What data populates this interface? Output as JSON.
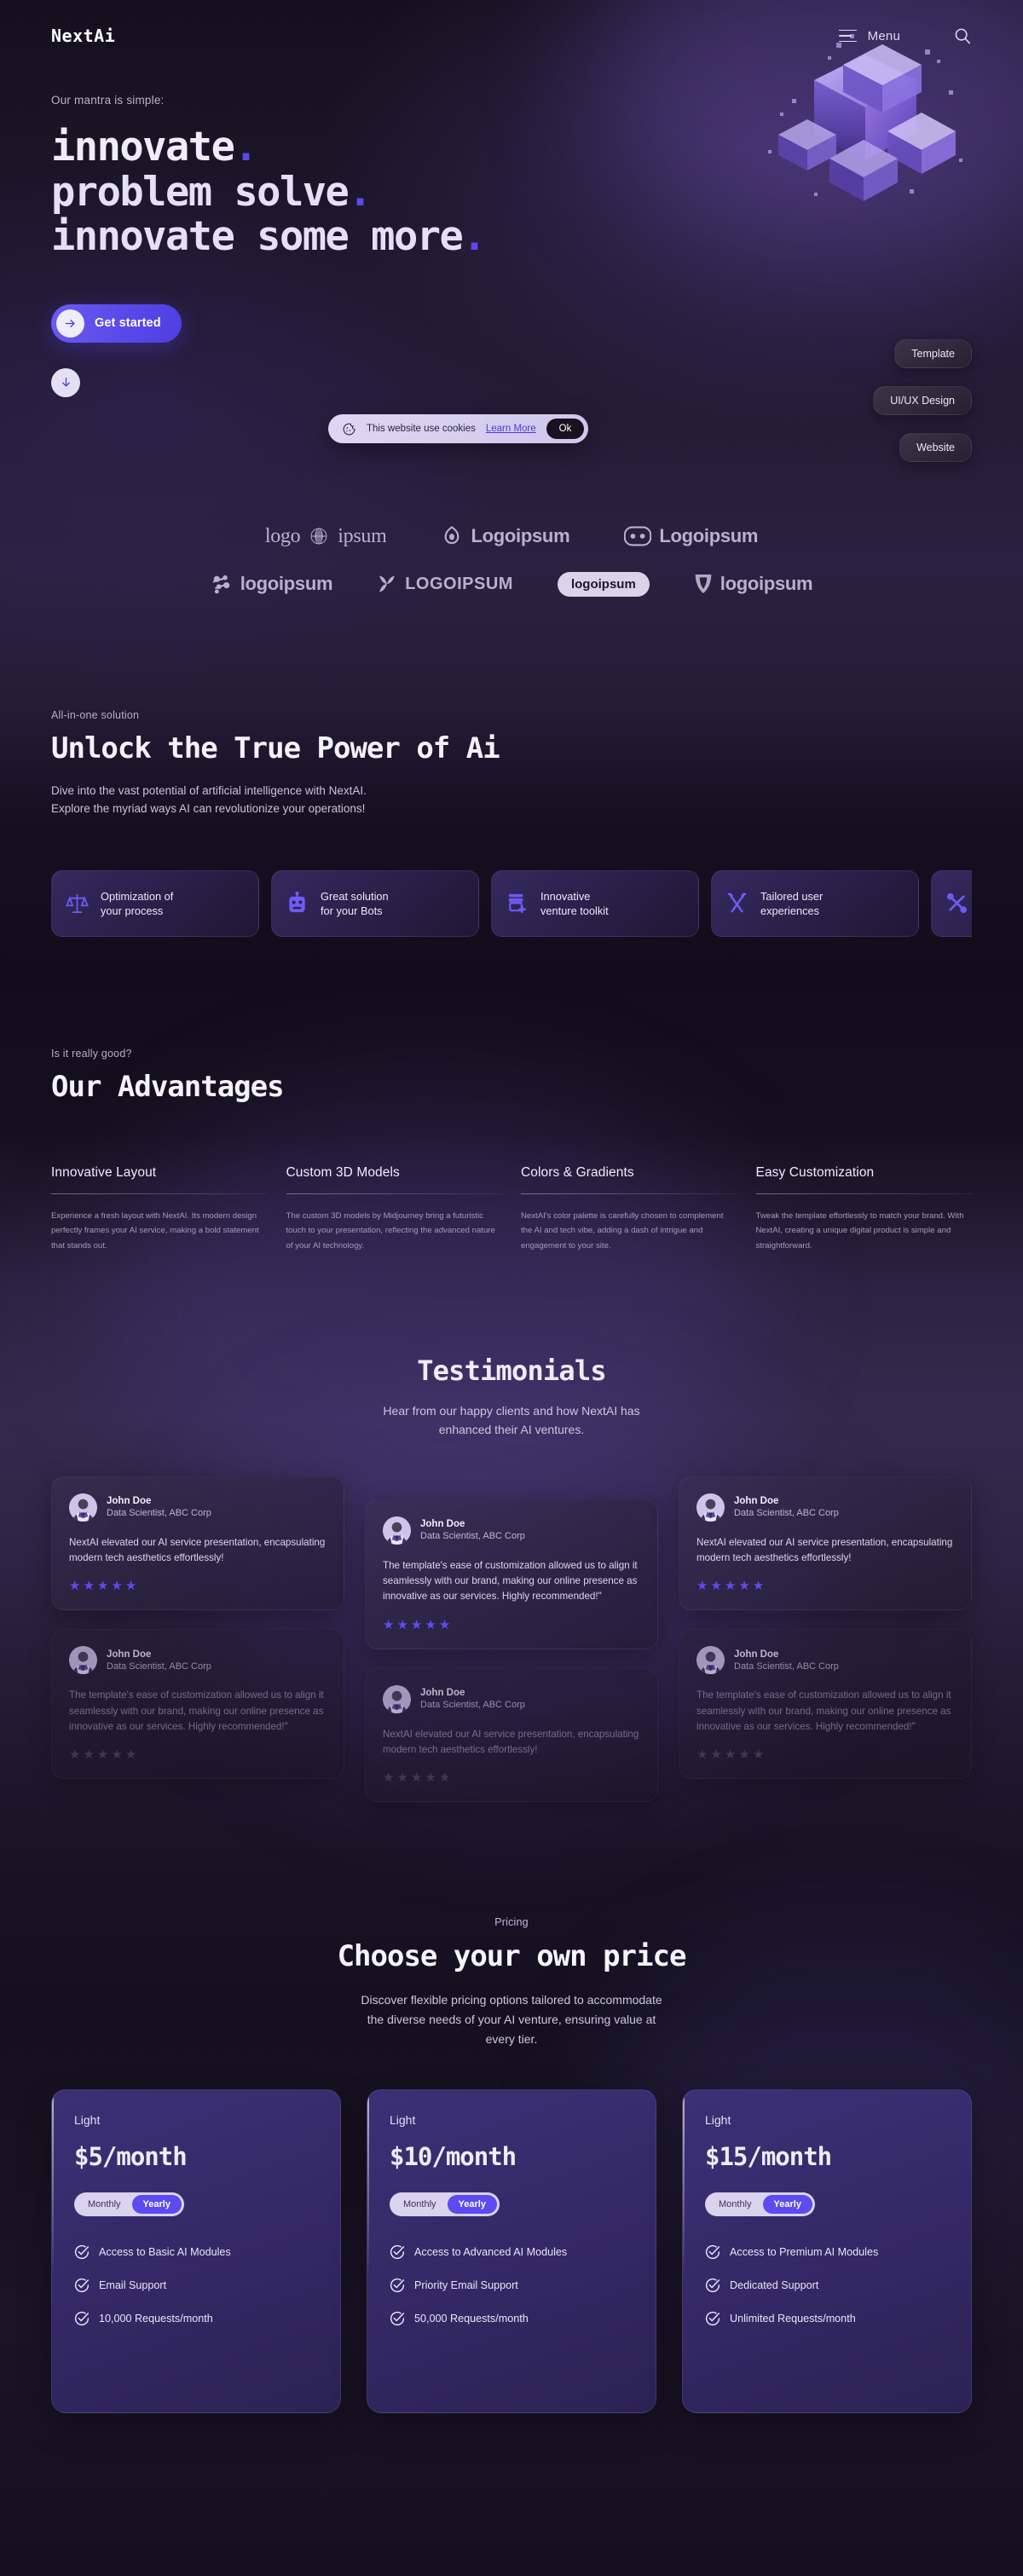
{
  "header": {
    "logo": "NextAi",
    "menu_label": "Menu",
    "menu_icon": "hamburger-icon",
    "search_icon": "search-icon"
  },
  "hero": {
    "kicker": "Our mantra is simple:",
    "line1": "innovate",
    "line2": "Problem solve",
    "line3": "innovate some more",
    "dot": ".",
    "cta_label": "Get started",
    "cta_icon": "arrow-right-icon",
    "scroll_icon": "arrow-down-icon",
    "art": "3d-cube-cluster"
  },
  "cookie": {
    "icon": "cookie-icon",
    "text": "This website use cookies",
    "link": "Learn More",
    "ok": "Ok"
  },
  "chips": [
    {
      "label": "Template"
    },
    {
      "label": "UI/UX Design"
    },
    {
      "label": "Website"
    }
  ],
  "logos": {
    "row1": [
      {
        "text_before": "logo",
        "text_after": "ipsum",
        "icon": "globe-logo-icon",
        "style": "serif"
      },
      {
        "text_before": "",
        "text_after": "Logoipsum",
        "icon": "drop-logo-icon",
        "style": "bold"
      },
      {
        "text_before": "",
        "text_after": "Logoipsum",
        "icon": "robot-face-logo-icon",
        "style": "bold"
      }
    ],
    "row2": [
      {
        "text_before": "",
        "text_after": "logoipsum",
        "icon": "molecule-logo-icon",
        "style": "bold"
      },
      {
        "text_before": "",
        "text_after": "LOGOIPSUM",
        "icon": "butterfly-logo-icon",
        "style": "cond"
      },
      {
        "text_before": "",
        "text_after": "logoipsum",
        "icon": "pill-logo",
        "style": "pill"
      },
      {
        "text_before": "",
        "text_after": "logoipsum",
        "icon": "shield-logo-icon",
        "style": "bold"
      }
    ]
  },
  "unlock": {
    "eyebrow": "All-in-one solution",
    "title": "Unlock the True Power of Ai",
    "para_line1": "Dive into the vast potential of artificial intelligence with NextAI.",
    "para_line2": "Explore the myriad ways AI can revolutionize your operations!",
    "cards": [
      {
        "icon": "scales-icon",
        "line1": "Optimization of",
        "line2": "your process"
      },
      {
        "icon": "robot-icon",
        "line1": "Great solution",
        "line2": "for your Bots"
      },
      {
        "icon": "storefront-plus-icon",
        "line1": "Innovative",
        "line2": "venture toolkit"
      },
      {
        "icon": "tools-cross-icon",
        "line1": "Tailored user",
        "line2": "experiences"
      },
      {
        "icon": "knot-link-icon",
        "line1": "",
        "line2": ""
      }
    ]
  },
  "advantages": {
    "eyebrow": "Is it really good?",
    "title": "Our Advantages",
    "items": [
      {
        "title": "Innovative Layout",
        "desc": "Experience a fresh layout with NextAI. Its modern design perfectly frames your AI service, making a bold statement that stands out."
      },
      {
        "title": "Custom 3D Models",
        "desc": "The custom 3D models by Midjourney bring a futuristic touch to your presentation, reflecting the advanced nature of your AI technology."
      },
      {
        "title": "Colors & Gradients",
        "desc": "NextAI's color palette is carefully chosen to complement the AI and tech vibe, adding a dash of intrigue and engagement to your site."
      },
      {
        "title": "Easy Customization",
        "desc": "Tweak the template effortlessly to match your brand. With NextAI, creating a unique digital product is simple and straightforward."
      }
    ]
  },
  "testimonials": {
    "title": "Testimonials",
    "sub_line1": "Hear from our happy clients and how NextAI has",
    "sub_line2": "enhanced their AI ventures.",
    "quote_a": "NextAI elevated our AI service presentation, encapsulating modern tech aesthetics effortlessly!",
    "quote_b": "The template's ease of customization allowed us to align it seamlessly with our brand, making our online presence as innovative as our services. Highly recommended!\"",
    "name": "John Doe",
    "role": "Data Scientist, ABC Corp",
    "stars": 5,
    "star_glyph": "★",
    "columns": [
      [
        {
          "quote_key": "quote_a",
          "dim": false
        },
        {
          "quote_key": "quote_b",
          "dim": true
        }
      ],
      [
        {
          "quote_key": "quote_b",
          "dim": false
        },
        {
          "quote_key": "quote_a",
          "dim": true
        }
      ],
      [
        {
          "quote_key": "quote_a",
          "dim": false
        },
        {
          "quote_key": "quote_b",
          "dim": true
        }
      ]
    ]
  },
  "pricing": {
    "eyebrow": "Pricing",
    "title": "Choose your own price",
    "sub_line1": "Discover flexible pricing options tailored to accommodate",
    "sub_line2": "the diverse needs of your AI venture, ensuring value at",
    "sub_line3": "every tier.",
    "toggle": {
      "monthly": "Monthly",
      "yearly": "Yearly",
      "active": "Yearly"
    },
    "check_icon": "check-circle-icon",
    "plans": [
      {
        "tier": "Light",
        "price": "$5/month",
        "features": [
          "Access to Basic AI Modules",
          "Email Support",
          "10,000 Requests/month"
        ]
      },
      {
        "tier": "Light",
        "price": "$10/month",
        "features": [
          "Access to Advanced AI Modules",
          "Priority Email Support",
          "50,000 Requests/month"
        ]
      },
      {
        "tier": "Light",
        "price": "$15/month",
        "features": [
          "Access to Premium AI Modules",
          "Dedicated Support",
          "Unlimited Requests/month"
        ]
      }
    ]
  },
  "colors": {
    "bg": "#17111f",
    "accent": "#5b4bf0",
    "accent_light": "#6a5bf0",
    "text": "#efecfb",
    "muted": "#b4adc9",
    "card_purple": "#3b3076",
    "star": "#5d4cf0"
  }
}
